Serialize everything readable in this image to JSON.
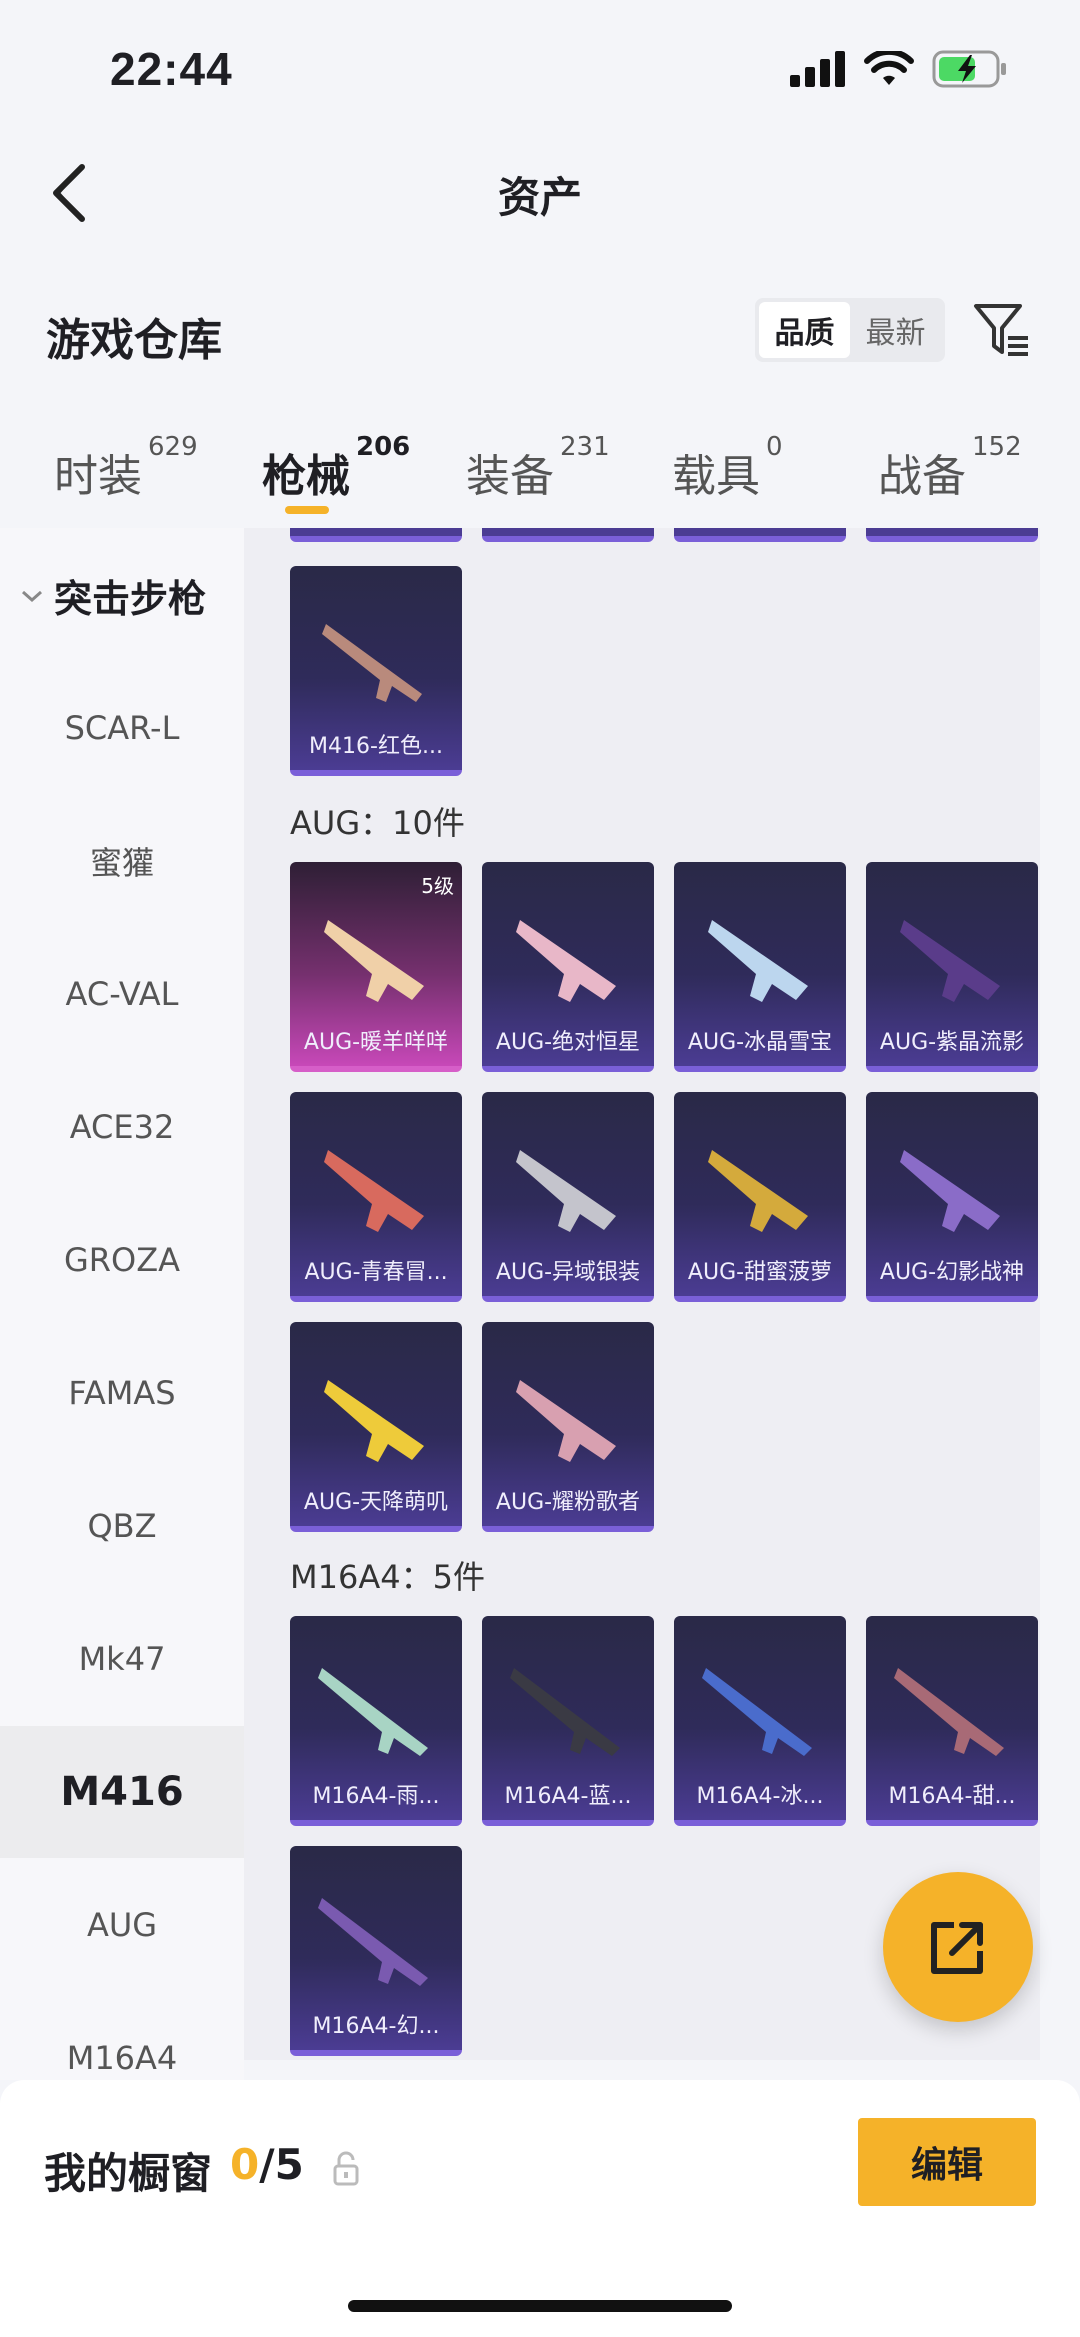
{
  "status": {
    "time": "22:44"
  },
  "nav": {
    "title": "资产"
  },
  "section": {
    "title": "游戏仓库",
    "sort_quality": "品质",
    "sort_newest": "最新"
  },
  "tabs": [
    {
      "label": "时装",
      "count": "629"
    },
    {
      "label": "枪械",
      "count": "206"
    },
    {
      "label": "装备",
      "count": "231"
    },
    {
      "label": "载具",
      "count": "0"
    },
    {
      "label": "战备",
      "count": "152"
    }
  ],
  "sidebar": {
    "group": "突击步枪",
    "items": [
      "SCAR-L",
      "蜜獾",
      "AC-VAL",
      "ACE32",
      "GROZA",
      "FAMAS",
      "QBZ",
      "Mk47",
      "M416",
      "AUG",
      "M16A4"
    ]
  },
  "content": {
    "m416_items": [
      "M416-红色..."
    ],
    "aug_label": "AUG：10件",
    "aug_items": [
      {
        "name": "AUG-暖羊咩咩",
        "level": "5级"
      },
      {
        "name": "AUG-绝对恒星"
      },
      {
        "name": "AUG-冰晶雪宝"
      },
      {
        "name": "AUG-紫晶流影"
      },
      {
        "name": "AUG-青春冒..."
      },
      {
        "name": "AUG-异域银装"
      },
      {
        "name": "AUG-甜蜜菠萝"
      },
      {
        "name": "AUG-幻影战神"
      },
      {
        "name": "AUG-天降萌叽"
      },
      {
        "name": "AUG-耀粉歌者"
      }
    ],
    "m16_label": "M16A4：5件",
    "m16_items": [
      "M16A4-雨...",
      "M16A4-蓝...",
      "M16A4-冰...",
      "M16A4-甜...",
      "M16A4-幻..."
    ]
  },
  "bottom": {
    "showcase_label": "我的橱窗",
    "showcase_current": "0",
    "showcase_total": "/5",
    "edit_label": "编辑"
  },
  "colors": {
    "accent": "#f5b229",
    "card_purple": "#4b3c93",
    "card_pink": "#c748b8"
  }
}
